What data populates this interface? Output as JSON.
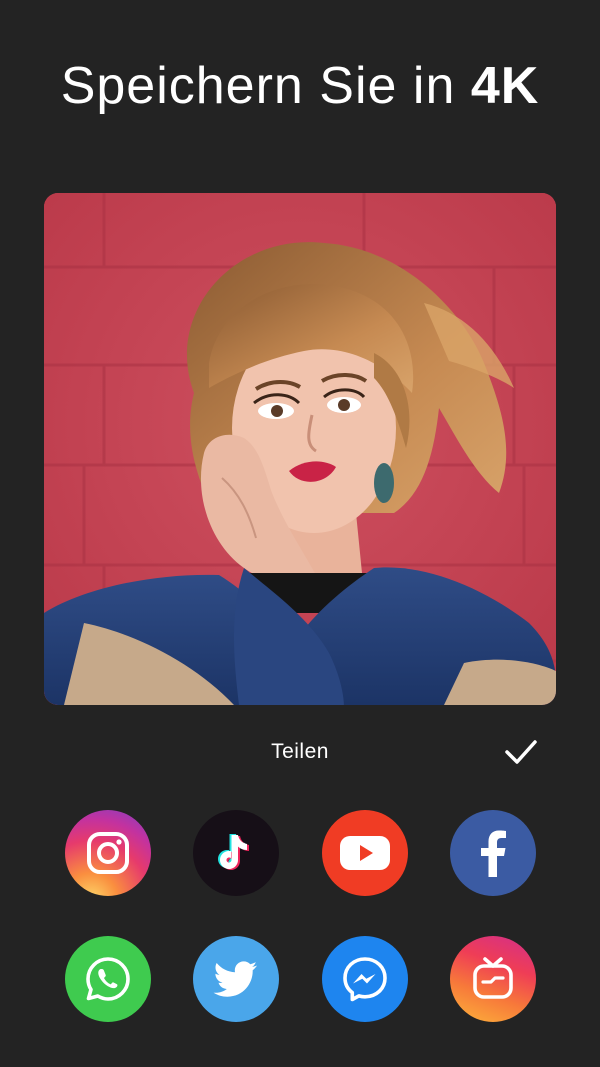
{
  "headline": {
    "text_regular": "Speichern Sie in ",
    "text_bold": "4K"
  },
  "preview": {
    "icon": "portrait-photo",
    "wall_color": "#c8475a"
  },
  "share_bar": {
    "label": "Teilen",
    "confirm_icon": "checkmark-icon"
  },
  "share_targets": [
    {
      "icon": "instagram-icon",
      "color": "#d6249f"
    },
    {
      "icon": "tiktok-icon",
      "color": "#161016"
    },
    {
      "icon": "youtube-icon",
      "color": "#f03c24"
    },
    {
      "icon": "facebook-icon",
      "color": "#3b5ba3"
    },
    {
      "icon": "whatsapp-icon",
      "color": "#3fcb4f"
    },
    {
      "icon": "twitter-icon",
      "color": "#4aa6ea"
    },
    {
      "icon": "messenger-icon",
      "color": "#1e85ef"
    },
    {
      "icon": "igtv-icon",
      "color": "#f5542e"
    }
  ]
}
